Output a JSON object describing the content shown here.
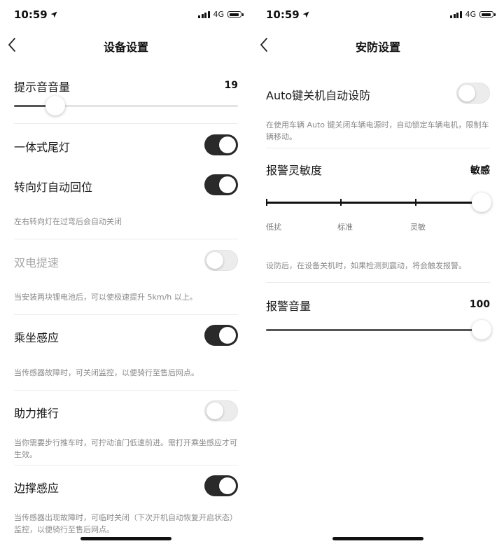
{
  "left": {
    "status": {
      "time": "10:59",
      "network": "4G"
    },
    "nav": {
      "title": "设备设置"
    },
    "volume": {
      "label": "提示音音量",
      "value": "19",
      "level_percent": 19
    },
    "items": [
      {
        "label": "一体式尾灯",
        "on": true
      },
      {
        "label": "转向灯自动回位",
        "on": true,
        "desc": "左右转向灯在过弯后会自动关闭"
      },
      {
        "label": "双电提速",
        "on": false,
        "disabled": true,
        "desc": "当安装两块锂电池后，可以使极速提升 5km/h 以上。"
      },
      {
        "label": "乘坐感应",
        "on": true,
        "desc": "当传感器故障时，可关闭监控，以便骑行至售后网点。"
      },
      {
        "label": "助力推行",
        "on": false,
        "desc": "当你需要步行推车时，可拧动油门低速前进。需打开乘坐感应才可生效。"
      },
      {
        "label": "边撑感应",
        "on": true,
        "desc": "当传感器出现故障时，可临时关闭（下次开机自动恢复开启状态）监控，以便骑行至售后网点。"
      }
    ]
  },
  "right": {
    "status": {
      "time": "10:59",
      "network": "4G"
    },
    "nav": {
      "title": "安防设置"
    },
    "auto_lock": {
      "label": "Auto键关机自动设防",
      "on": false,
      "desc": "在使用车辆 Auto 键关闭车辆电源时，自动锁定车辆电机，限制车辆移动。"
    },
    "sensitivity": {
      "label": "报警灵敏度",
      "value": "敏感",
      "ticks": [
        "低扰",
        "标准",
        "灵敏",
        "敏感"
      ],
      "selected_index": 3,
      "desc": "设防后，在设备关机时，如果检测到震动，将会触发报警。"
    },
    "alarm_volume": {
      "label": "报警音量",
      "value": "100",
      "level_percent": 100
    }
  },
  "icons": {
    "location": "location-arrow-icon",
    "signal": "signal-bars-icon",
    "battery": "battery-icon",
    "back": "chevron-left-icon"
  },
  "colors": {
    "toggle_on": "#2a2a2a",
    "toggle_off": "#ececec",
    "text": "#1a1a1a",
    "muted": "#8a8a8a"
  }
}
